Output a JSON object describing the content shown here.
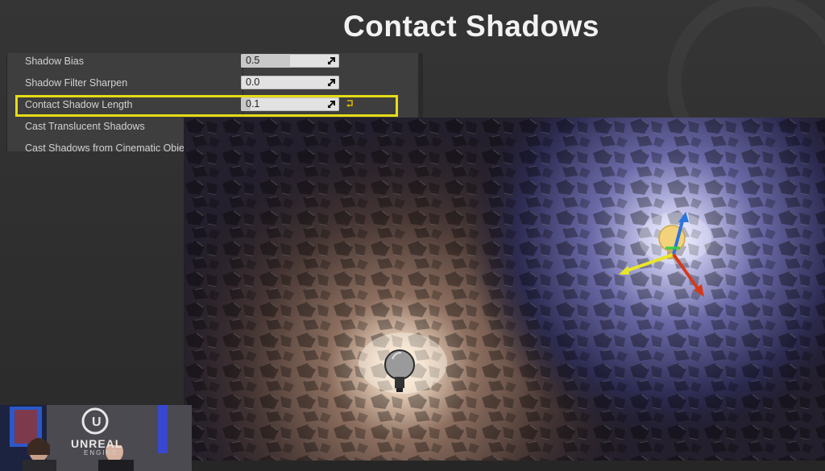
{
  "slide": {
    "title": "Contact Shadows"
  },
  "details_panel": {
    "rows": [
      {
        "label": "Shadow Bias",
        "value": "0.5",
        "fill": 0.5
      },
      {
        "label": "Shadow Filter Sharpen",
        "value": "0.0",
        "fill": 0.0
      },
      {
        "label": "Contact Shadow Length",
        "value": "0.1",
        "fill": 0.1,
        "highlighted": true
      },
      {
        "label": "Cast Translucent Shadows",
        "checked": false
      },
      {
        "label": "Cast Shadows from Cinematic Objects Only",
        "checked": false
      }
    ],
    "highlight_color": "#e6dc16"
  },
  "webcam": {
    "logo_text": "UNREAL",
    "logo_subtext": "ENGINE"
  },
  "icons": [
    "light-bulb-icon",
    "transform-gizmo-icon",
    "reset-arrow-icon",
    "slider-arrow-icon"
  ]
}
